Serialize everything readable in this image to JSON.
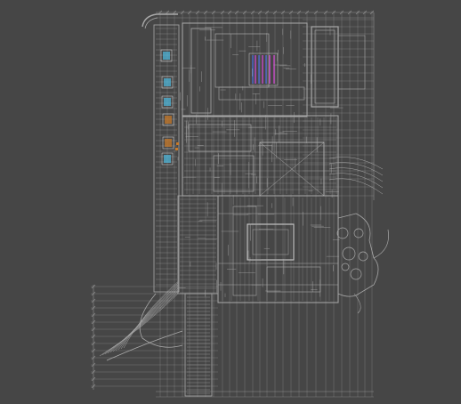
{
  "view": {
    "type": "cad-drawing-viewport",
    "background_color": "#464646",
    "line_color": "#a9a9a9",
    "dim_line_color": "#8f8f8f",
    "accent_colors": {
      "magenta": "#d04ad0",
      "blue": "#4b6bd6",
      "orange": "#c77a2a",
      "cyan": "#4fb6d8"
    }
  }
}
